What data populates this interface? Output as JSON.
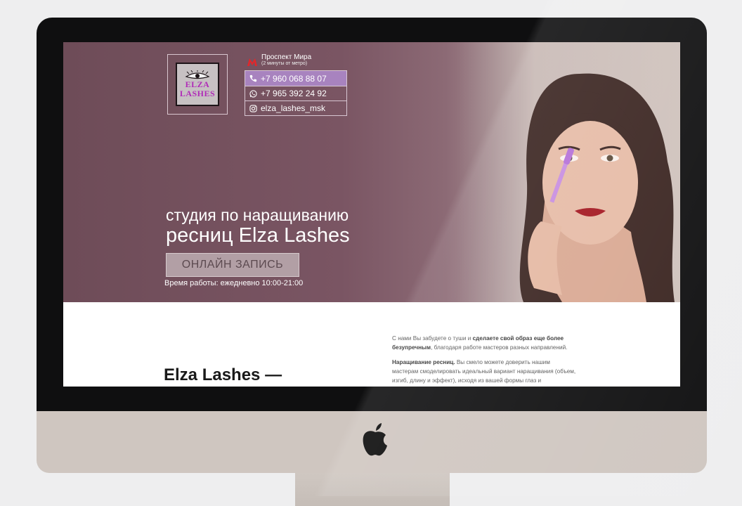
{
  "hero": {
    "metro": {
      "icon": "metro-icon",
      "name": "Проспект Мира",
      "note": "(2 минуты от метро)"
    },
    "contacts": [
      {
        "icon": "phone-icon",
        "text": "+7 960 068 88 07",
        "active": true
      },
      {
        "icon": "whatsapp-icon",
        "text": "+7 965 392 24 92",
        "active": false
      },
      {
        "icon": "instagram-icon",
        "text": "elza_lashes_msk",
        "active": false
      }
    ],
    "logo": {
      "line1": "ELZA",
      "line2": "LASHES"
    },
    "headline_line1": "студия по наращиванию",
    "headline_line2": "ресниц Elza Lashes",
    "cta_label": "ОНЛАЙН ЗАПИСЬ",
    "hours": "Время работы: ежедневно 10:00-21:00"
  },
  "about": {
    "heading": "Elza Lashes —",
    "p1_a": "С нами Вы забудете о туши и ",
    "p1_b": "сделаете свой образ еще более безупречным",
    "p1_c": ", благодаря работе мастеров разных направлений.",
    "p2_a": "Наращивание ресниц.",
    "p2_b": " Вы смело можете доверить нашим мастерам смоделировать идеальный вариант наращивания (объем, изгиб, длину и эффект), исходя из вашей формы глаз и"
  },
  "colors": {
    "hero": "#7a5563",
    "accent": "#a883bf",
    "cta": "#b29fa5"
  }
}
